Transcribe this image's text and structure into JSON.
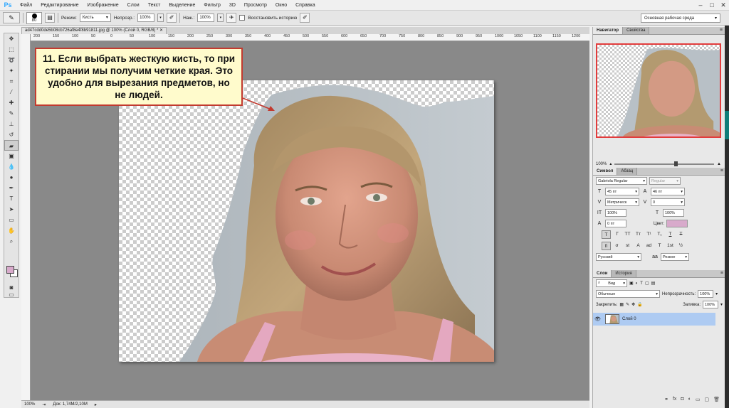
{
  "app": {
    "logo": "Ps",
    "menu": [
      "Файл",
      "Редактирование",
      "Изображение",
      "Слои",
      "Текст",
      "Выделение",
      "Фильтр",
      "3D",
      "Просмотр",
      "Окно",
      "Справка"
    ],
    "window_controls": [
      "–",
      "□",
      "✕"
    ]
  },
  "options": {
    "brush_size": "80",
    "mode_label": "Режим:",
    "mode_value": "Кисть",
    "opacity_label": "Непрозр.:",
    "opacity_value": "100%",
    "flow_label": "Наж.:",
    "flow_value": "100%",
    "history_label": "Восстановить историю",
    "workspace": "Основная рабочая среда"
  },
  "document": {
    "tab_title": "ad47cdd0de5b08cb726af8e4f8b91811.jpg @ 100% (Слой 0, RGB/8) *",
    "ruler_ticks": [
      "200",
      "150",
      "100",
      "50",
      "0",
      "50",
      "100",
      "150",
      "200",
      "250",
      "300",
      "350",
      "400",
      "450",
      "500",
      "550",
      "600",
      "650",
      "700",
      "750",
      "800",
      "850",
      "900",
      "950",
      "1000",
      "1050",
      "1100",
      "1150",
      "1200",
      "1250"
    ],
    "zoom": "100%",
    "doc_info": "Док: 1,74M/2,10M"
  },
  "callout": {
    "text": "11. Если выбрать жесткую кисть, то при стирании мы получим четкие края. Это удобно для вырезания предметов, но не людей."
  },
  "navigator": {
    "tabs": [
      "Навигатор",
      "Свойства"
    ],
    "zoom": "100%"
  },
  "character": {
    "tabs": [
      "Символ",
      "Абзац"
    ],
    "font_family": "Gabriola Regular",
    "font_style": "Regular",
    "font_size": "45 пт",
    "leading": "46 пт",
    "kerning": "Метрическ",
    "tracking": "0",
    "vscale": "100%",
    "hscale": "100%",
    "baseline": "0 пт",
    "color_label": "Цвет:",
    "style_buttons": [
      "T",
      "T",
      "TT",
      "Tт",
      "T¹",
      "T₁",
      "T",
      "T"
    ],
    "opentype_buttons": [
      "fi",
      "σ",
      "st",
      "A",
      "ad",
      "T",
      "1st",
      "½"
    ],
    "language": "Русский",
    "antialias_icon": "aa",
    "antialias": "Резкое"
  },
  "layers": {
    "tabs": [
      "Слои",
      "История"
    ],
    "filter_label": "Вид",
    "blend_mode": "Обычные",
    "opacity_label": "Непрозрачность:",
    "opacity": "100%",
    "lock_label": "Закрепить:",
    "fill_label": "Заливка:",
    "fill": "100%",
    "items": [
      {
        "name": "Слой 0"
      }
    ],
    "footer_icons": [
      "link-icon",
      "fx-icon",
      "mask-icon",
      "adjustment-icon",
      "folder-icon",
      "new-layer-icon",
      "trash-icon"
    ]
  },
  "tools": [
    "move-tool",
    "marquee-tool",
    "lasso-tool",
    "quick-select-tool",
    "crop-tool",
    "eyedropper-tool",
    "healing-tool",
    "brush-tool",
    "clone-stamp-tool",
    "history-brush-tool",
    "eraser-tool",
    "gradient-tool",
    "blur-tool",
    "dodge-tool",
    "pen-tool",
    "type-tool",
    "path-select-tool",
    "shape-tool",
    "hand-tool",
    "zoom-tool"
  ],
  "colors": {
    "foreground": "#d8aacb",
    "background": "#ffffff",
    "callout_border": "#c23a2f",
    "callout_fill": "#fffbcc",
    "layer_selected": "#aecbf2",
    "navigator_frame": "#e23c3c"
  }
}
